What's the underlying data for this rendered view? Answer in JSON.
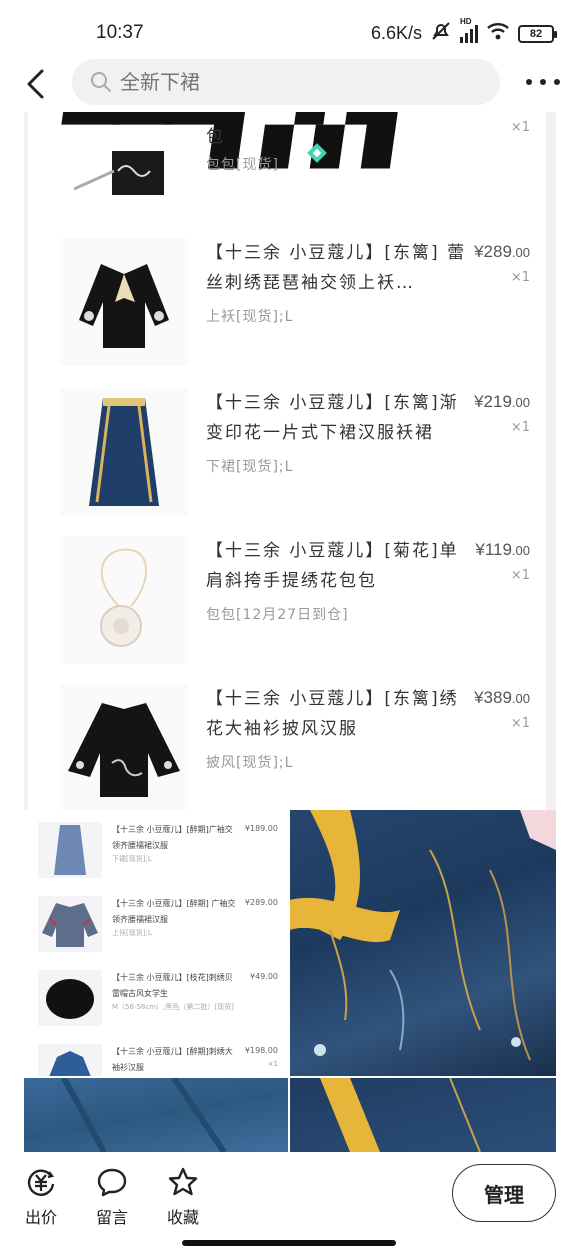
{
  "status_bar": {
    "time": "10:37",
    "network_speed": "6.6K/s",
    "signal_label": "HD",
    "battery": "82"
  },
  "nav": {
    "search_placeholder": "全新下裙"
  },
  "order_items": [
    {
      "title": "",
      "price_int": "",
      "price_dec": "",
      "qty": "×1",
      "spec": "包包[现货]"
    },
    {
      "title": "【十三余 小豆蔻儿】[东篱] 蕾丝刺绣琵琶袖交领上袄…",
      "price_int": "¥289",
      "price_dec": ".00",
      "qty": "×1",
      "spec": "上袄[现货];L"
    },
    {
      "title": "【十三余 小豆蔻儿】[东篱]渐变印花一片式下裙汉服袄裙",
      "price_int": "¥219",
      "price_dec": ".00",
      "qty": "×1",
      "spec": "下裙[现货];L"
    },
    {
      "title": "【十三余 小豆蔻儿】[菊花]单肩斜挎手提绣花包包",
      "price_int": "¥119",
      "price_dec": ".00",
      "qty": "×1",
      "spec": "包包[12月27日到仓]"
    },
    {
      "title": "【十三余 小豆蔻儿】[东篱]绣花大袖衫披风汉服",
      "price_int": "¥389",
      "price_dec": ".00",
      "qty": "×1",
      "spec": "披风[现货];L"
    }
  ],
  "mini_items": [
    {
      "title": "【十三余 小豆蔻儿】[醉期]广袖交领齐腰襦裙汉服",
      "price": "¥189.00",
      "qty": "×1",
      "spec": "下裙[现货];L"
    },
    {
      "title": "【十三余 小豆蔻儿】[醉期] 广袖交领齐腰襦裙汉服",
      "price": "¥289.00",
      "qty": "×1",
      "spec": "上袄[现货];L"
    },
    {
      "title": "【十三余 小豆蔻儿】[枝花]刺绣贝雷帽古风女学生",
      "price": "¥49.00",
      "qty": "×1",
      "spec": "M（56-58cm）;黑色（第二批）[现货]"
    },
    {
      "title": "【十三余 小豆蔻儿】[醉期]刺绣大袖衫汉服",
      "price": "¥198.00",
      "qty": "×1",
      "spec": ""
    }
  ],
  "bottom_bar": {
    "offer_label": "出价",
    "message_label": "留言",
    "favorite_label": "收藏",
    "manage_label": "管理"
  },
  "colors": {
    "card_border": "#f5f0f4",
    "dress_blue": "#27466e",
    "ribbon_yellow": "#e7b53a",
    "brand_green": "#3fd6b0"
  }
}
